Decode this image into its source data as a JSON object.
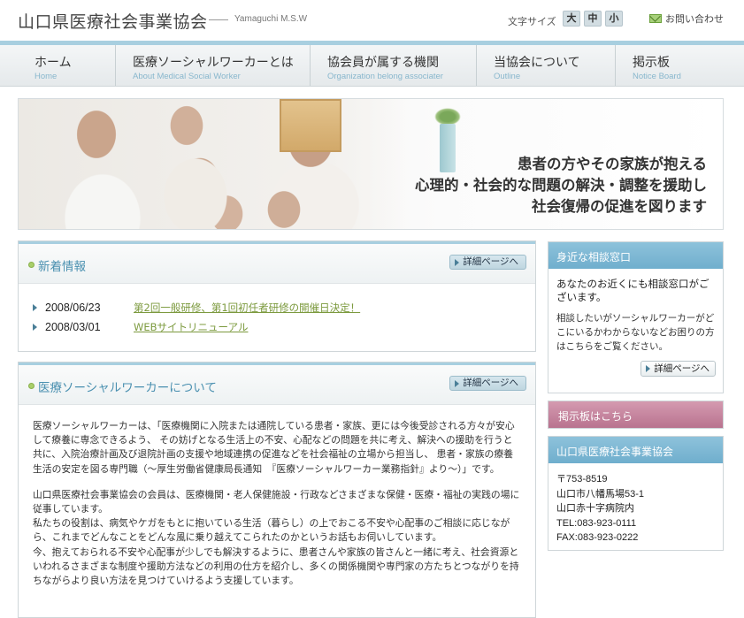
{
  "header": {
    "site_title": "山口県医療社会事業協会",
    "site_sub": "Yamaguchi M.S.W",
    "font_size_label": "文字サイズ",
    "font_size_large": "大",
    "font_size_medium": "中",
    "font_size_small": "小",
    "contact": "お問い合わせ"
  },
  "nav": {
    "items": [
      {
        "jp": "ホーム",
        "en": "Home"
      },
      {
        "jp": "医療ソーシャルワーカーとは",
        "en": "About Medical Social Worker"
      },
      {
        "jp": "協会員が属する機関",
        "en": "Organization belong associater"
      },
      {
        "jp": "当協会について",
        "en": "Outline"
      },
      {
        "jp": "掲示板",
        "en": "Notice Board"
      }
    ]
  },
  "hero": {
    "line1": "患者の方やその家族が抱える",
    "line2": "心理的・社会的な問題の解決・調整を援助し",
    "line3": "社会復帰の促進を図ります"
  },
  "news": {
    "title": "新着情報",
    "detail_label": "詳細ページへ",
    "items": [
      {
        "date": "2008/06/23",
        "text": "第2回一般研修、第1回初任者研修の開催日決定！"
      },
      {
        "date": "2008/03/01",
        "text": "WEBサイトリニューアル"
      }
    ]
  },
  "about": {
    "title": "医療ソーシャルワーカーについて",
    "detail_label": "詳細ページへ",
    "para1": "医療ソーシャルワーカーは、「医療機関に入院または通院している患者・家族、更には今後受診される方々が安心して療養に専念できるよう、 その妨げとなる生活上の不安、心配などの問題を共に考え、解決への援助を行うと共に、入院治療計画及び退院計画の支援や地域連携の促進などを社会福祉の立場から担当し、 患者・家族の療養生活の安定を図る専門職（〜厚生労働省健康局長通知　『医療ソーシャルワーカー業務指針』より〜）」です。",
    "para2a": "山口県医療社会事業協会の会員は、医療機関・老人保健施設・行政などさまざまな保健・医療・福祉の実践の場に従事しています。",
    "para2b": "私たちの役割は、病気やケガをもとに抱いている生活（暮らし）の上でおこる不安や心配事のご相談に応じながら、これまでどんなことをどんな風に乗り越えてこられたのかというお話もお伺いしています。",
    "para2c": "今、抱えておられる不安や心配事が少しでも解決するように、患者さんや家族の皆さんと一緒に考え、社会資源といわれるさまざまな制度や援助方法などの利用の仕方を紹介し、多くの関係機関や専門家の方たちとつながりを持ちながらより良い方法を見つけていけるよう支援しています。"
  },
  "sidebar": {
    "consult_title": "身近な相談窓口",
    "consult_lead": "あなたのお近くにも相談窓口がございます。",
    "consult_body": "相談したいがソーシャルワーカーがどこにいるかわからないなどお困りの方はこちらをご覧ください。",
    "consult_btn": "詳細ページへ",
    "board_link": "掲示板はこちら",
    "org_title": "山口県医療社会事業協会",
    "org_zip": "〒753-8519",
    "org_addr1": "山口市八幡馬場53-1",
    "org_addr2": "山口赤十字病院内",
    "org_tel": "TEL:083-923-0111",
    "org_fax": "FAX:083-923-0222"
  },
  "colors": {
    "accent_blue": "#6faecd",
    "accent_pink": "#b9738f",
    "link_green": "#7c9a3e"
  }
}
